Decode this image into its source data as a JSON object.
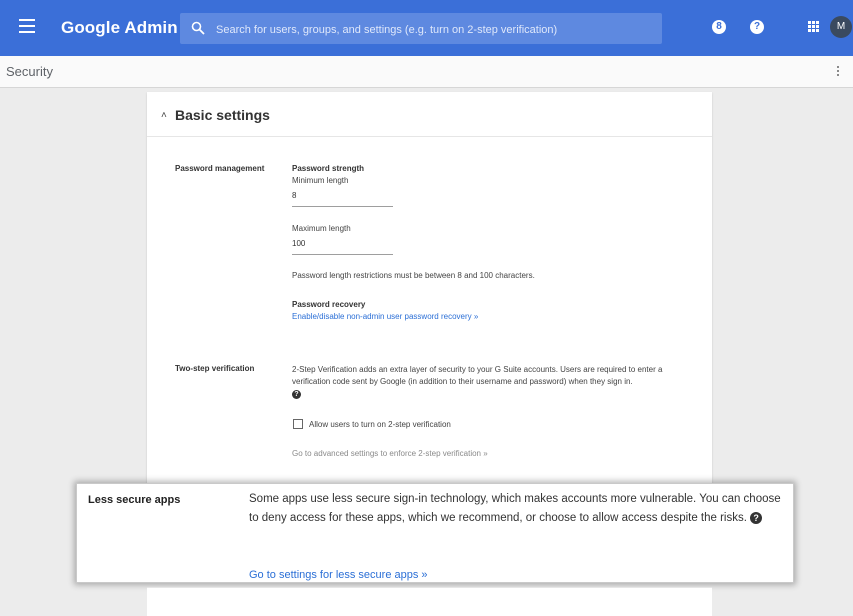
{
  "topbar": {
    "brand": "Google Admin",
    "search_placeholder": "Search for users, groups, and settings (e.g. turn on 2-step verification)",
    "support_badge": "8",
    "help_badge": "?",
    "avatar_letter": "M",
    "bar_color": "#3b6fd8"
  },
  "subbar": {
    "title": "Security"
  },
  "card": {
    "title": "Basic settings",
    "password": {
      "section_label": "Password management",
      "strength_heading": "Password strength",
      "min_label": "Minimum length",
      "min_value": "8",
      "max_label": "Maximum length",
      "max_value": "100",
      "restriction_note": "Password length restrictions must be between 8 and 100 characters.",
      "recovery_heading": "Password recovery",
      "recovery_link": "Enable/disable non-admin user password recovery »"
    },
    "two_step": {
      "section_label": "Two-step verification",
      "description": "2-Step Verification adds an extra layer of security to your G Suite accounts. Users are required to enter a verification code sent by Google (in addition to their username and password) when they sign in.",
      "checkbox_label": "Allow users to turn on 2-step verification",
      "advanced_link": "Go to advanced settings to enforce 2-step verification »"
    }
  },
  "callout": {
    "label": "Less secure apps",
    "description": "Some apps use less secure sign-in technology, which makes accounts more vulnerable. You can choose to deny access for these apps, which we recommend, or choose to allow access despite the risks.",
    "link": "Go to settings for less secure apps »"
  }
}
